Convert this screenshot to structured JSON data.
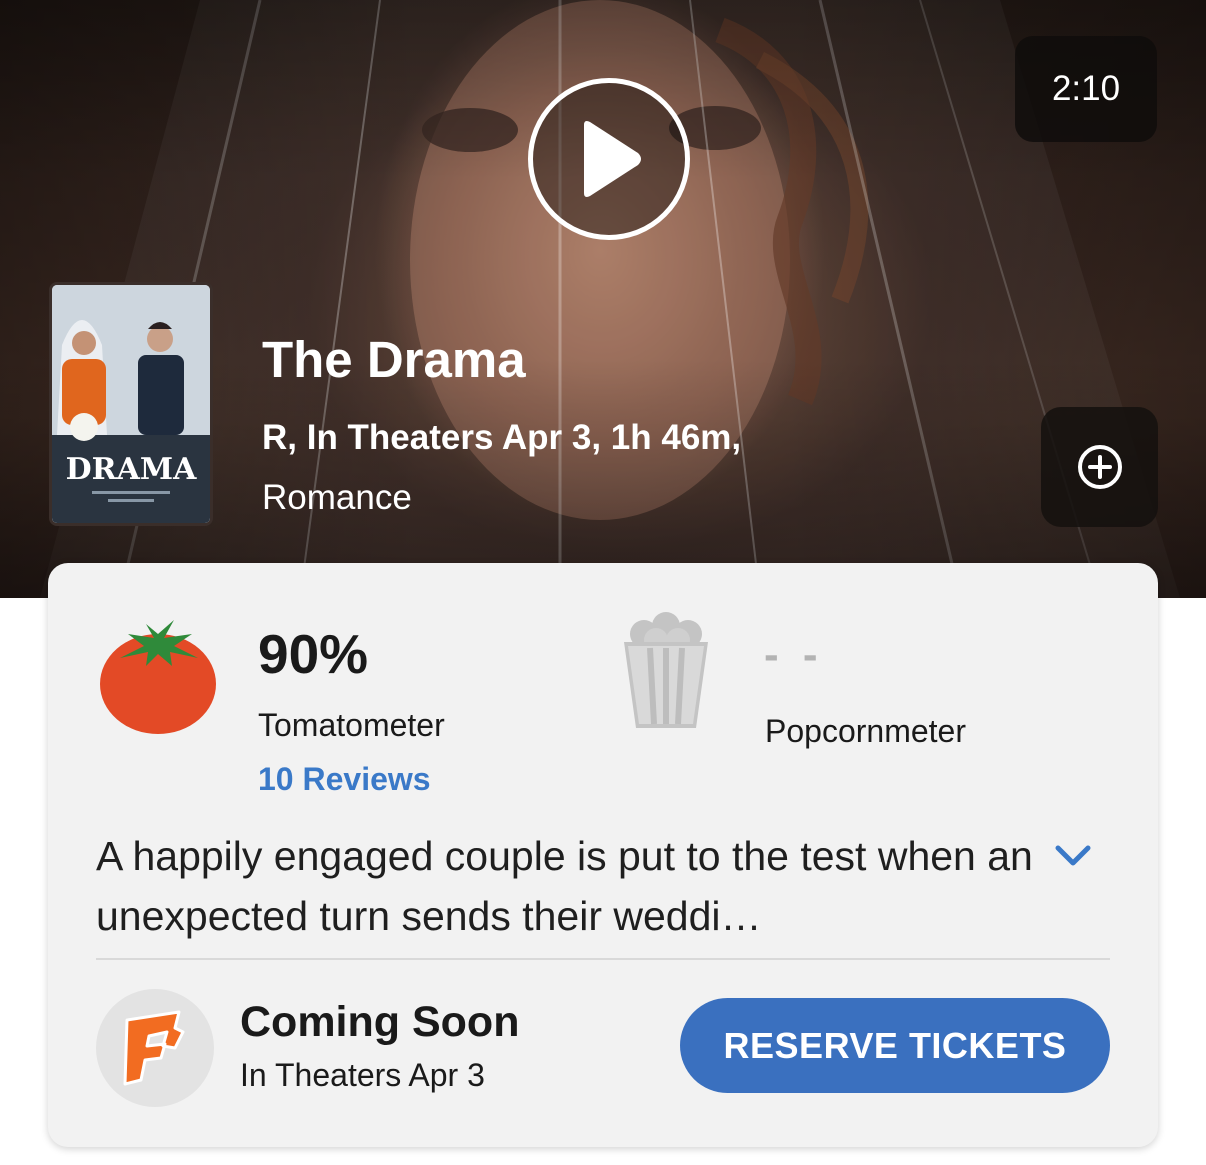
{
  "trailer": {
    "duration": "2:10"
  },
  "movie": {
    "title": "The Drama",
    "meta_line1": "R, In Theaters Apr 3, 1h 46m,",
    "meta_line2": "Romance",
    "poster_title": "DRAMA"
  },
  "scores": {
    "tomatometer": {
      "value": "90%",
      "label": "Tomatometer",
      "reviews": "10 Reviews"
    },
    "popcornmeter": {
      "value": "- -",
      "label": "Popcornmeter"
    }
  },
  "synopsis": {
    "text": "A happily engaged couple is put to the test when an unexpected turn sends their weddi…"
  },
  "tickets": {
    "status": "Coming Soon",
    "release": "In Theaters Apr 3",
    "button_label": "RESERVE TICKETS"
  },
  "colors": {
    "accent_blue": "#3a70bf",
    "link_blue": "#3a79c8",
    "tomato_red": "#e34a26",
    "fandango_orange": "#f26c21"
  }
}
